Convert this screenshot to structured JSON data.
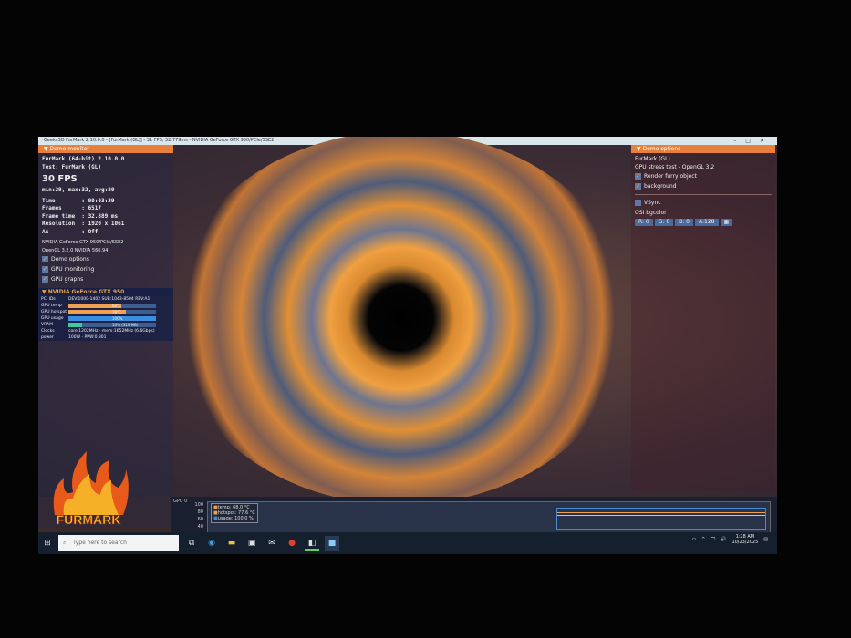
{
  "window": {
    "title": "Geeks3D FurMark 2.10.0.0 - [FurMark (GL)] - 31 FPS, 32.779ms - NVIDIA GeForce GTX 950/PCIe/SSE2"
  },
  "monitor": {
    "header": "Demo monitor",
    "app": "FurMark (64-bit) 2.10.0.0",
    "test": "Test: FurMark (GL)",
    "fps": "30 FPS",
    "fps_stats": "min:29, max:32, avg:30",
    "stats": [
      "Time        : 00:03:39",
      "Frames      : 6517",
      "Frame time  : 32.889 ms",
      "Resolution  : 1920 x 1061",
      "AA          : Off"
    ],
    "renderer": "NVIDIA GeForce GTX 950/PCIe/SSE2",
    "opengl": "OpenGL 3.2.0 NVIDIA 560.94",
    "checks": [
      "Demo options",
      "GPU monitoring",
      "GPU graphs"
    ]
  },
  "gpu": {
    "header": "NVIDIA GeForce GTX 950",
    "pci_label": "PCI IDs",
    "pci": "DEV:1000-1402 SUB:1043-8504 REV:A1",
    "bars": [
      {
        "label": "GPU temp",
        "value": "68°C",
        "fill": 60,
        "color": "#f0a050"
      },
      {
        "label": "GPU hotspot",
        "value": "78°C",
        "fill": 66,
        "color": "#f0a050"
      },
      {
        "label": "GPU usage",
        "value": "100%",
        "fill": 100,
        "color": "#3a8ee0"
      },
      {
        "label": "VRAM",
        "value": "16% (319 MB)",
        "fill": 16,
        "color": "#40c8a0"
      }
    ],
    "clocks_label": "Clocks",
    "clocks": "core:1202MHz - mem:1652MHz (6.6Gbps)",
    "power_label": "power",
    "power": "100W - PPW:0.301"
  },
  "options": {
    "header": "Demo options",
    "app": "FurMark (GL)",
    "test": "GPU stress test - OpenGL 3.2",
    "checks": [
      "Render furry object",
      "background"
    ],
    "vsync": "VSync",
    "osi_label": "OSI bgcolor",
    "buttons": [
      "R: 0",
      "G: 0",
      "B: 0",
      "A:128"
    ]
  },
  "graph": {
    "label": "GPU 0",
    "ticks": [
      "100",
      "80",
      "60",
      "40"
    ],
    "legend": [
      "temp: 68.0 °C",
      "hotspot: 77.6 °C",
      "usage: 100.0 %"
    ]
  },
  "logo": "FURMARK",
  "taskbar": {
    "search_placeholder": "Type here to search",
    "time": "1:28 AM",
    "date": "10/23/2025"
  }
}
